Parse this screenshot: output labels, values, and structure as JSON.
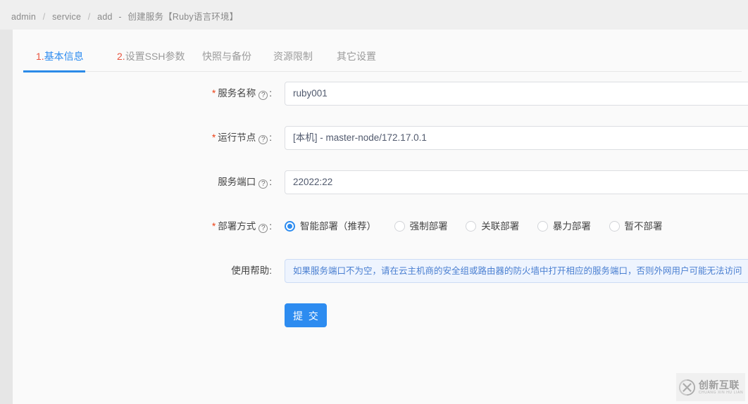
{
  "breadcrumb": {
    "items": [
      "admin",
      "service",
      "add"
    ],
    "separator": "/",
    "dash": "-",
    "title": "创建服务【Ruby语言环境】"
  },
  "tabs": [
    {
      "num": "1.",
      "label": "基本信息",
      "active": true
    },
    {
      "num": "2.",
      "label": "设置SSH参数",
      "active": false
    },
    {
      "num": "",
      "label": "快照与备份",
      "active": false
    },
    {
      "num": "",
      "label": "资源限制",
      "active": false
    },
    {
      "num": "",
      "label": "其它设置",
      "active": false
    }
  ],
  "form": {
    "fields": [
      {
        "required": true,
        "label": "服务名称",
        "help_icon": "?",
        "colon": ":",
        "value": "ruby001"
      },
      {
        "required": true,
        "label": "运行节点",
        "help_icon": "?",
        "colon": ":",
        "value": "[本机] - master-node/172.17.0.1"
      },
      {
        "required": false,
        "label": "服务端口",
        "help_icon": "?",
        "colon": ":",
        "value": "22022:22"
      }
    ],
    "deploy": {
      "required": true,
      "label": "部署方式",
      "help_icon": "?",
      "colon": ":",
      "options": [
        {
          "label": "智能部署（推荐）",
          "checked": true
        },
        {
          "label": "强制部署",
          "checked": false
        },
        {
          "label": "关联部署",
          "checked": false
        },
        {
          "label": "暴力部署",
          "checked": false
        },
        {
          "label": "暂不部署",
          "checked": false
        }
      ]
    },
    "usage_help": {
      "label": "使用帮助",
      "colon": ":",
      "text": "如果服务端口不为空，请在云主机商的安全组或路由器的防火墙中打开相应的服务端口，否则外网用户可能无法访问"
    },
    "submit_label": "提 交"
  },
  "watermark": {
    "name": "创新互联",
    "pinyin": "CHUANG XIN HU LIAN"
  },
  "colors": {
    "primary": "#2d8cf0",
    "accent_red": "#e8543f",
    "required_red": "#ed4014",
    "help_bg": "#eef4fe",
    "help_text": "#4a7fd1"
  }
}
